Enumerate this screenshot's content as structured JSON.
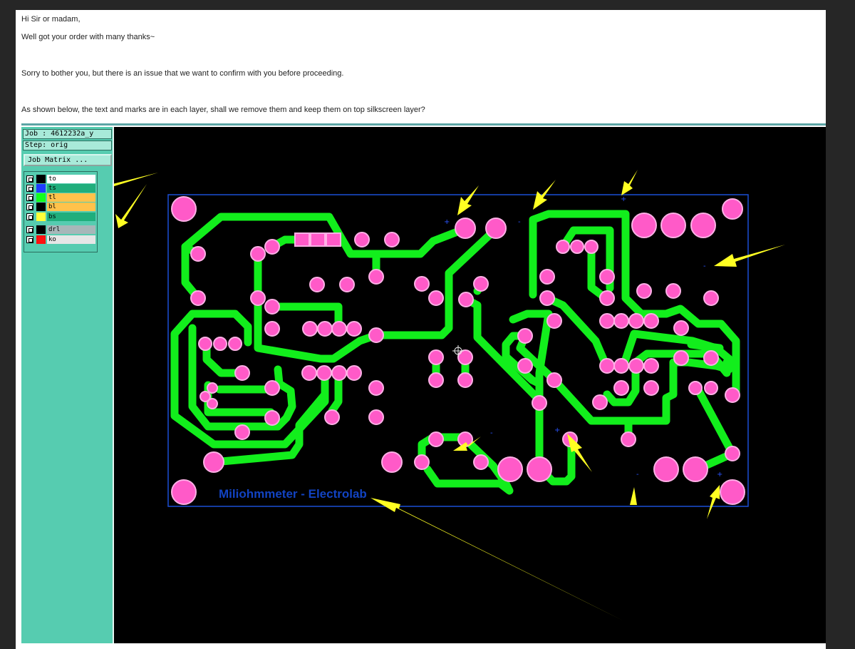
{
  "email": {
    "greeting": "Hi Sir or madam,",
    "thanks": "Well got your order with many thanks~",
    "issue": "Sorry to bother you, but there is an issue that we want to confirm with you before proceeding.",
    "question": "As shown below, the text and marks are in each layer, shall we remove them and keep them on top silkscreen layer?"
  },
  "viewer": {
    "job": "Job : 4612232a_y",
    "step": "Step: orig",
    "matrix_button": "Job Matrix ...",
    "layers": [
      {
        "name": "to",
        "swatch": "#000000",
        "bg": "#ffffff"
      },
      {
        "name": "ts",
        "swatch": "#1f3bff",
        "bg": "#1fae7c"
      },
      {
        "name": "tl",
        "swatch": "#12ff1c",
        "bg": "#ffc24b"
      },
      {
        "name": "bl",
        "swatch": "#000000",
        "bg": "#ffc24b"
      },
      {
        "name": "bs",
        "swatch": "#ffff3a",
        "bg": "#1fae7c"
      },
      {
        "name": "drl",
        "swatch": "#000000",
        "bg": "#a7b7b9"
      },
      {
        "name": "ko",
        "swatch": "#ff1010",
        "bg": "#e6e6e6"
      }
    ]
  },
  "board": {
    "silkscreen_text": "Miliohmmeter - Electrolab",
    "colors": {
      "background": "#000000",
      "trace": "#12ee1c",
      "pad": "#ff5ac8",
      "pad_ring": "#ffb0e6",
      "outline": "#1b4fd6",
      "silk_text": "#1243c2",
      "arrow": "#ffff22"
    }
  }
}
